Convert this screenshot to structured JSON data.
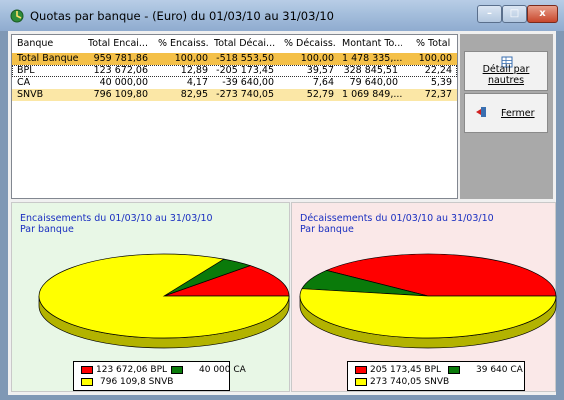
{
  "window": {
    "title": "Quotas par banque - (Euro) du 01/03/10 au 31/03/10",
    "controls": {
      "minimize": "–",
      "maximize": "□",
      "close": "x"
    }
  },
  "grid": {
    "columns": [
      "Banque",
      "Total Encai...",
      "% Encaiss.",
      "Total Décai...",
      "% Décaiss.",
      "Montant To...",
      "% Total"
    ],
    "rows": [
      {
        "banque": "Total Banque",
        "total_encai": "959 781,86",
        "pct_encaiss": "100,00",
        "total_decai": "-518 553,50",
        "pct_decaiss": "100,00",
        "montant_total": "1 478 335,...",
        "pct_total": "100,00"
      },
      {
        "banque": "BPL",
        "total_encai": "123 672,06",
        "pct_encaiss": "12,89",
        "total_decai": "-205 173,45",
        "pct_decaiss": "39,57",
        "montant_total": "328 845,51",
        "pct_total": "22,24"
      },
      {
        "banque": "CA",
        "total_encai": "40 000,00",
        "pct_encaiss": "4,17",
        "total_decai": "-39 640,00",
        "pct_decaiss": "7,64",
        "montant_total": "79 640,00",
        "pct_total": "5,39"
      },
      {
        "banque": "SNVB",
        "total_encai": "796 109,80",
        "pct_encaiss": "82,95",
        "total_decai": "-273 740,05",
        "pct_decaiss": "52,79",
        "montant_total": "1 069 849,...",
        "pct_total": "72,37"
      }
    ]
  },
  "actions": {
    "detail_label": "Détail par nautres",
    "fermer_label": "Fermer"
  },
  "colors": {
    "red": "#ff0000",
    "green": "#0a7a0a",
    "yellow": "#ffff00",
    "title_blue": "#1a2fc0"
  },
  "chart_data": [
    {
      "type": "pie",
      "title": "Encaissements du 01/03/10 au 31/03/10",
      "subtitle": "Par banque",
      "categories": [
        "BPL",
        "CA",
        "SNVB"
      ],
      "values": [
        123672.06,
        40000.0,
        796109.8
      ],
      "legend_labels": [
        "123 672,06 BPL",
        "40 000 CA",
        "796 109,8 SNVB"
      ],
      "colors": [
        "#ff0000",
        "#0a7a0a",
        "#ffff00"
      ],
      "legend": "bottom"
    },
    {
      "type": "pie",
      "title": "Décaissements du 01/03/10 au 31/03/10",
      "subtitle": "Par banque",
      "categories": [
        "BPL",
        "CA",
        "SNVB"
      ],
      "values": [
        205173.45,
        39640,
        273740.05
      ],
      "legend_labels": [
        "205 173,45 BPL",
        "39 640 CA",
        "273 740,05 SNVB"
      ],
      "colors": [
        "#ff0000",
        "#0a7a0a",
        "#ffff00"
      ],
      "legend": "bottom"
    }
  ]
}
